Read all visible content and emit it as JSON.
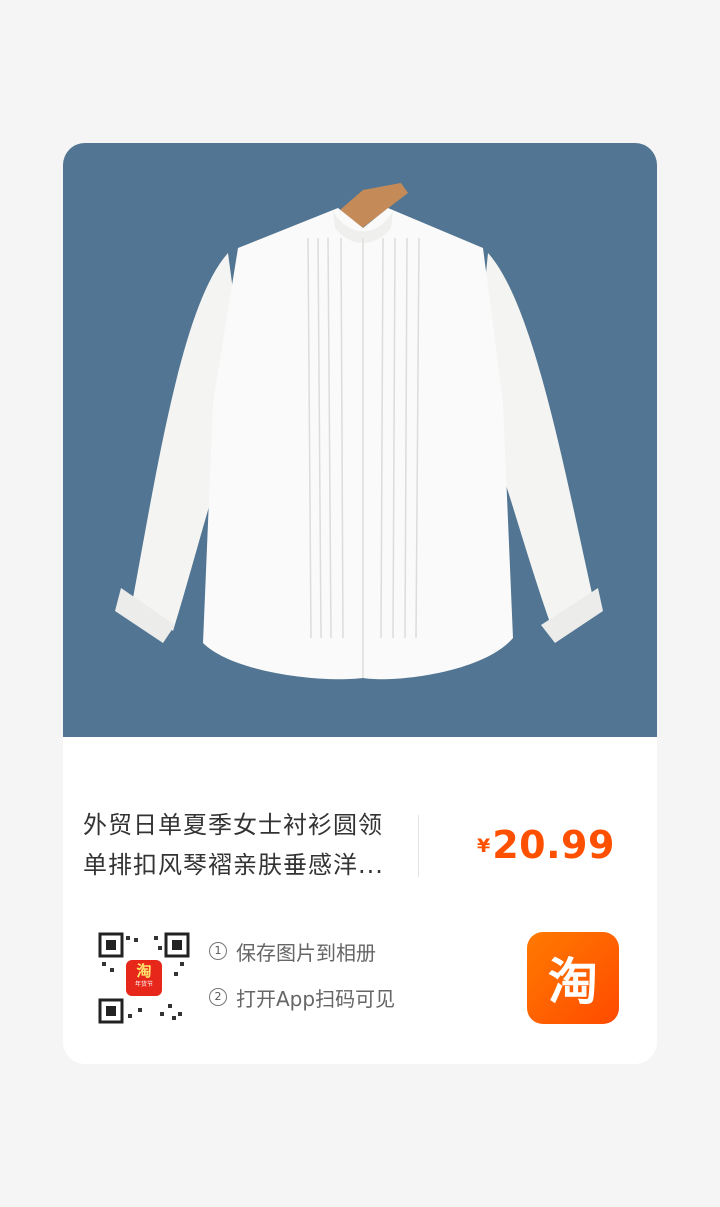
{
  "product": {
    "title_line1": "外贸日单夏季女士衬衫圆领",
    "title_line2": "单排扣风琴褶亲肤垂感洋...",
    "currency": "¥",
    "price": "20.99"
  },
  "share": {
    "step1_num": "1",
    "step1": "保存图片到相册",
    "step2_num": "2",
    "step2": "打开App扫码可见",
    "app_icon_char": "淘",
    "qr_badge_char": "淘",
    "qr_badge_sub": "年货节"
  },
  "colors": {
    "photo_bg": "#517592",
    "price": "#ff5000",
    "app_icon": "#ff5a00"
  }
}
